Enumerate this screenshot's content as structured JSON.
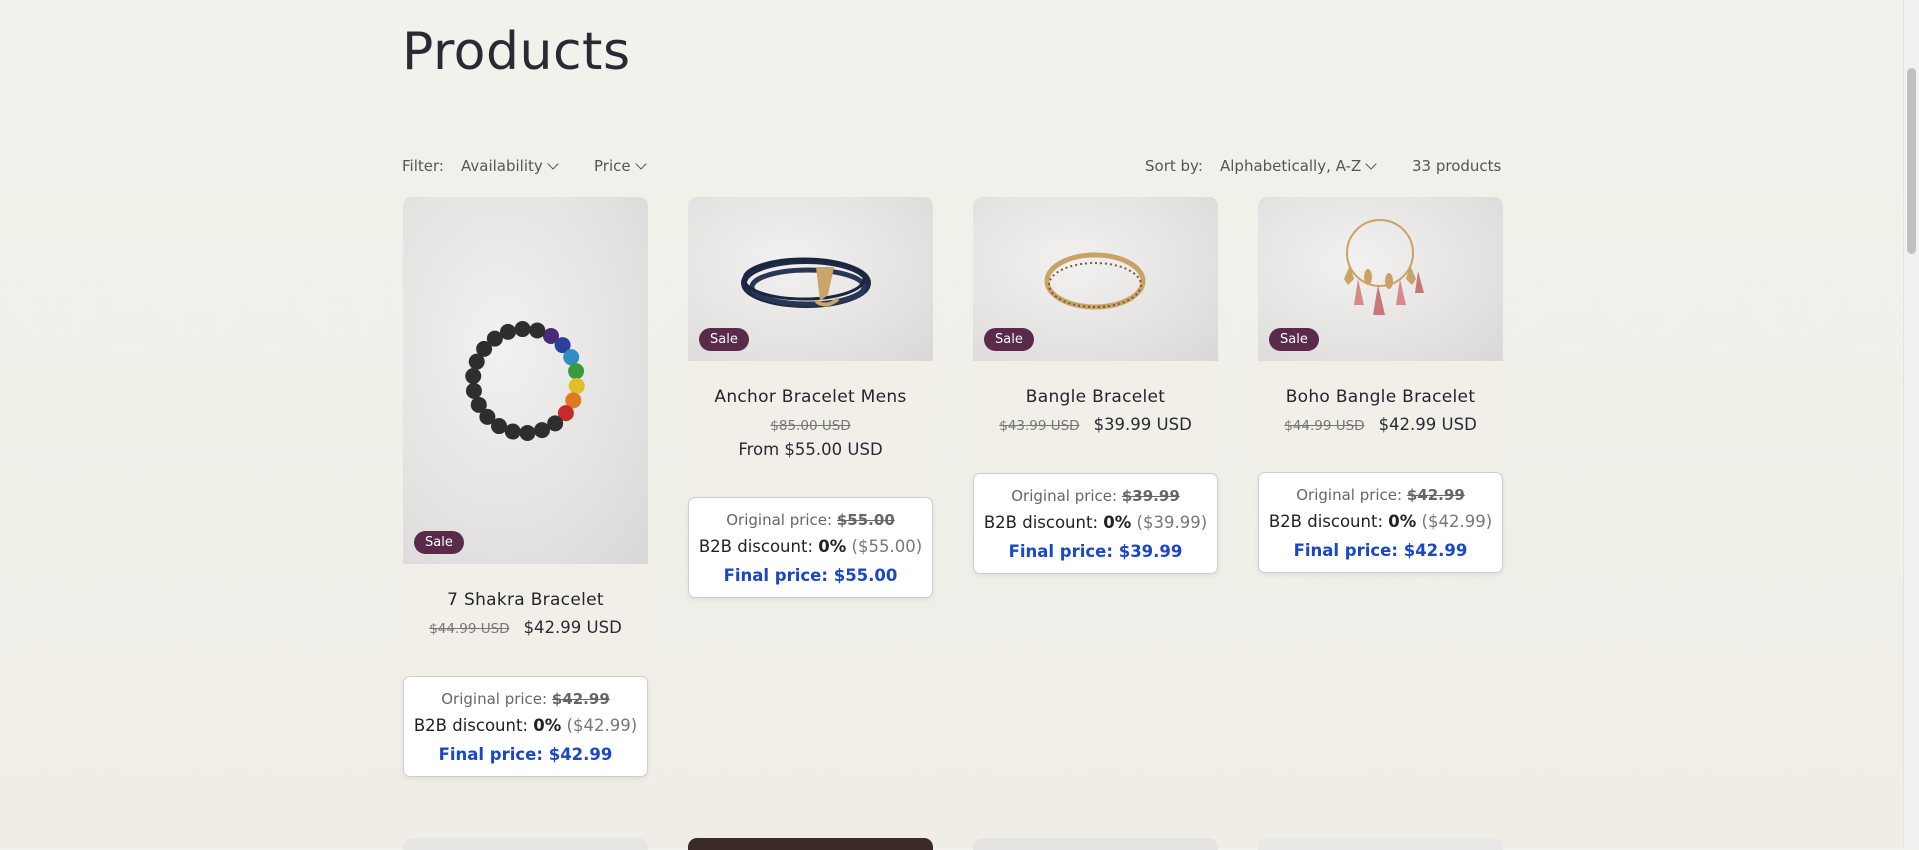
{
  "page": {
    "title": "Products"
  },
  "filter": {
    "label": "Filter:",
    "availability": "Availability",
    "price": "Price",
    "sort_label": "Sort by:",
    "sort_value": "Alphabetically, A-Z",
    "count": "33 products"
  },
  "products": [
    {
      "name": "7 Shakra Bracelet",
      "old_price": "$44.99 USD",
      "price": "$42.99 USD",
      "badge": "Sale",
      "b2b": {
        "orig_label": "Original price:",
        "orig_value": "$42.99",
        "disc_label": "B2B discount:",
        "disc_pct": "0%",
        "disc_amt": "($42.99)",
        "final": "Final price: $42.99"
      }
    },
    {
      "name": "Anchor Bracelet Mens",
      "old_price": "$85.00 USD",
      "price": "From $55.00 USD",
      "badge": "Sale",
      "b2b": {
        "orig_label": "Original price:",
        "orig_value": "$55.00",
        "disc_label": "B2B discount:",
        "disc_pct": "0%",
        "disc_amt": "($55.00)",
        "final": "Final price: $55.00"
      }
    },
    {
      "name": "Bangle Bracelet",
      "old_price": "$43.99 USD",
      "price": "$39.99 USD",
      "badge": "Sale",
      "b2b": {
        "orig_label": "Original price:",
        "orig_value": "$39.99",
        "disc_label": "B2B discount:",
        "disc_pct": "0%",
        "disc_amt": "($39.99)",
        "final": "Final price: $39.99"
      }
    },
    {
      "name": "Boho Bangle Bracelet",
      "old_price": "$44.99 USD",
      "price": "$42.99 USD",
      "badge": "Sale",
      "b2b": {
        "orig_label": "Original price:",
        "orig_value": "$42.99",
        "disc_label": "B2B discount:",
        "disc_pct": "0%",
        "disc_amt": "($42.99)",
        "final": "Final price: $42.99"
      }
    }
  ],
  "colors": {
    "sale_badge": "#5a2a4a",
    "final_price": "#1a47c8"
  }
}
